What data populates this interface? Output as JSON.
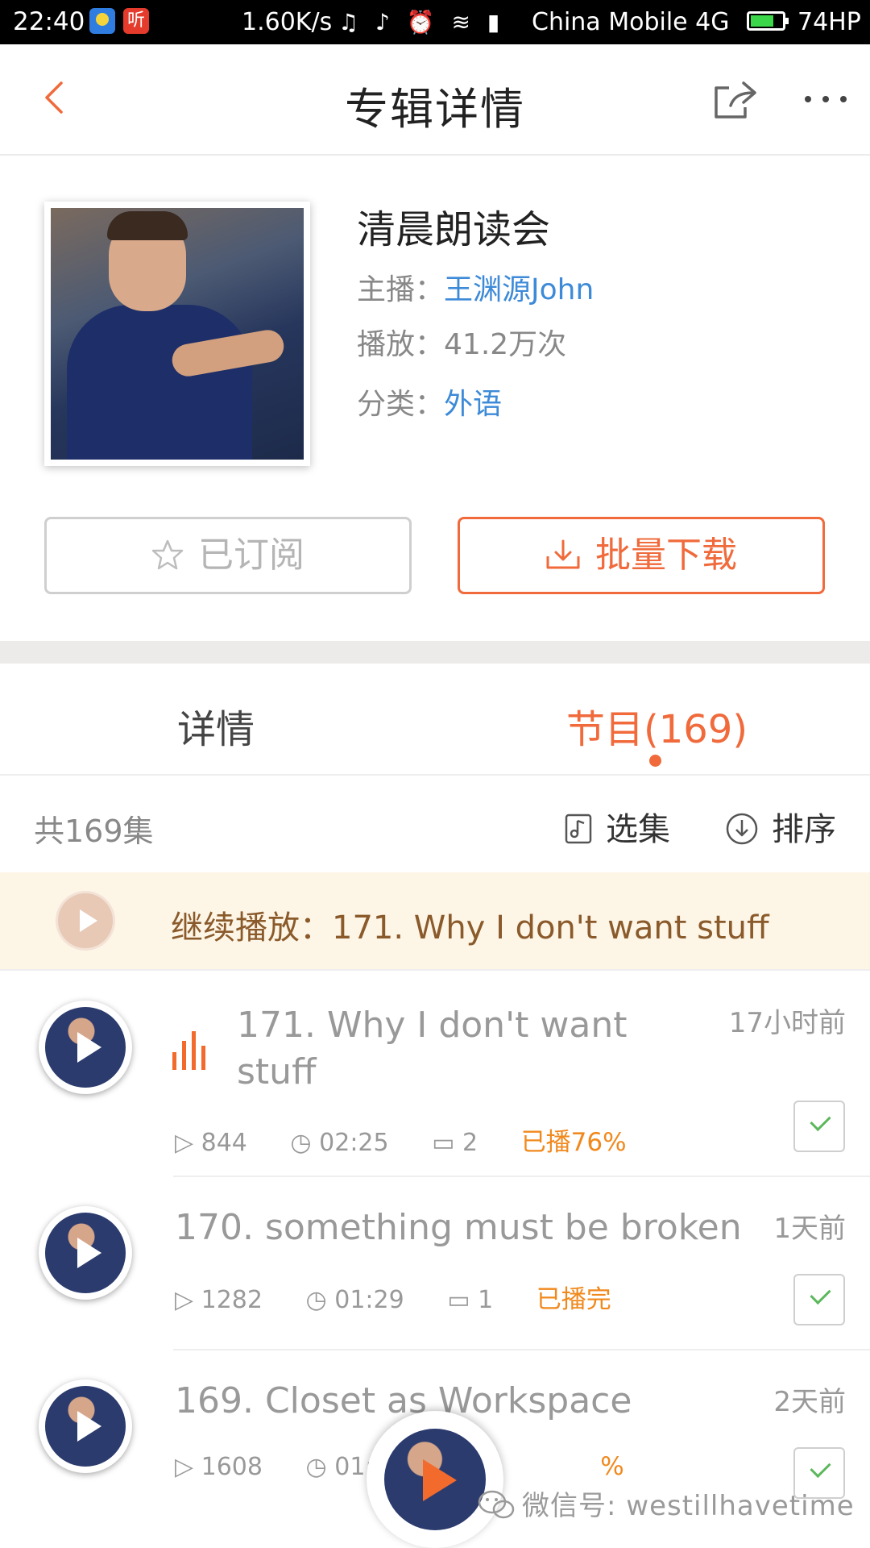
{
  "status_bar": {
    "time": "22:40",
    "app_icon_2_text": "听",
    "speed": "1.60K/s",
    "indicator_glyphs": "♫ ♪ ⏰ ≋ ▮",
    "carrier": "China Mobile 4G",
    "battery": "74HP",
    "battery_level": 0.74
  },
  "header": {
    "title": "专辑详情"
  },
  "album": {
    "title": "清晨朗读会",
    "host_label": "主播：",
    "host": "王渊源John",
    "plays_label": "播放：",
    "plays": "41.2万次",
    "category_label": "分类：",
    "category": "外语"
  },
  "buttons": {
    "subscribe": "已订阅",
    "download": "批量下载"
  },
  "tabs": {
    "detail": "详情",
    "programs": "节目(169)"
  },
  "list_bar": {
    "count": "共169集",
    "select": "选集",
    "sort": "排序"
  },
  "continue": {
    "text": "继续播放：171. Why I don't want stuff"
  },
  "episodes": [
    {
      "title_line1": "171. Why I don't want",
      "title_line2": "stuff",
      "time_ago": "17小时前",
      "plays": "844",
      "duration": "02:25",
      "comments": "2",
      "played": "已播76%"
    },
    {
      "title": "170. something must be broken",
      "time_ago": "1天前",
      "plays": "1282",
      "duration": "01:29",
      "comments": "1",
      "played": "已播完"
    },
    {
      "title": "169. Closet as Workspace",
      "time_ago": "2天前",
      "plays": "1608",
      "duration": "01:40",
      "played_partial": "%"
    }
  ],
  "watermark": "微信号: westillhavetime",
  "colors": {
    "accent": "#f06a3b",
    "link": "#3d8ad8",
    "played": "#f0891d",
    "continue_bg": "#fdf5e6"
  },
  "icons": [
    "back-icon",
    "share-icon",
    "more-icon",
    "star-icon",
    "download-icon",
    "select-icon",
    "sort-icon",
    "play-icon",
    "equalizer-icon",
    "check-icon",
    "wechat-icon"
  ]
}
